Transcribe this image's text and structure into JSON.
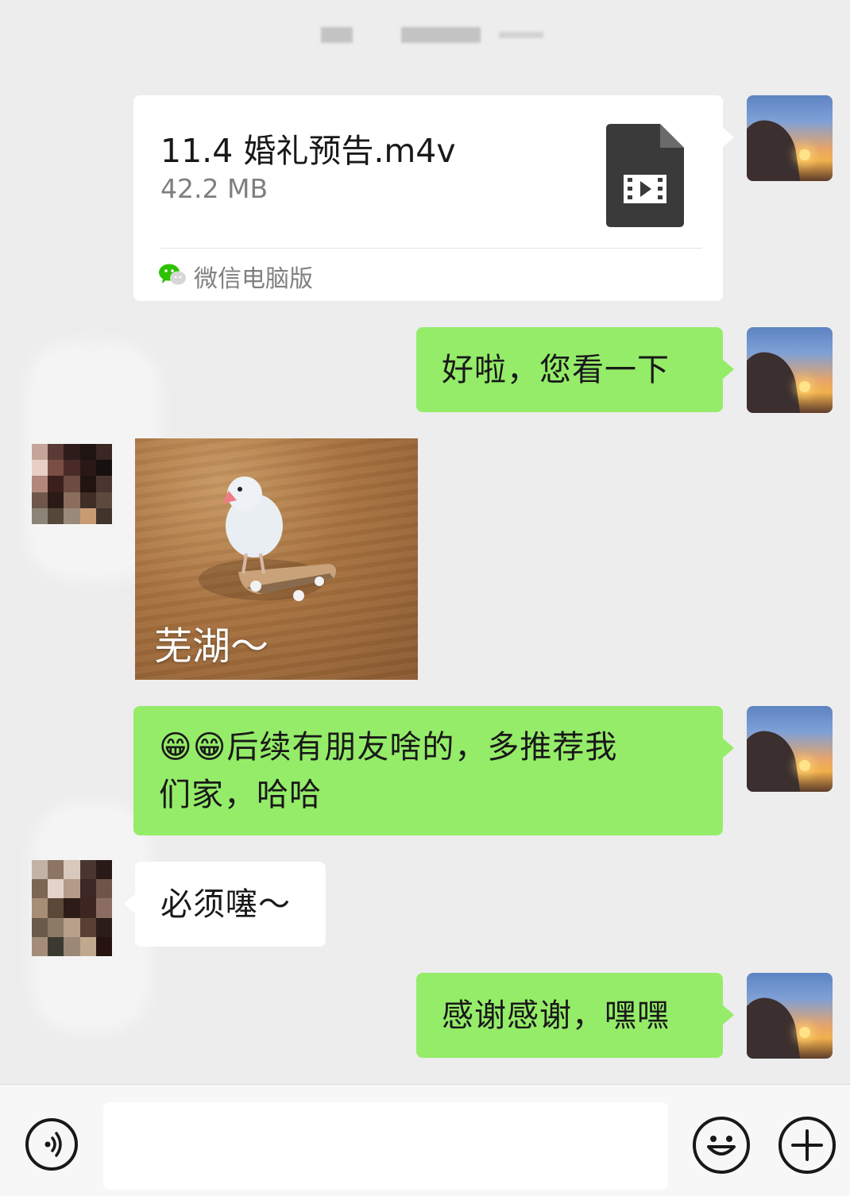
{
  "chat": {
    "messages": [
      {
        "id": "file",
        "sender": "me",
        "type": "file",
        "file_name": "11.4 婚礼预告.m4v",
        "file_size": "42.2 MB",
        "source": "微信电脑版",
        "file_icon": "video-file-icon"
      },
      {
        "id": "m1",
        "sender": "me",
        "type": "text",
        "text": "好啦，您看一下"
      },
      {
        "id": "m2",
        "sender": "other",
        "type": "image",
        "caption": "芜湖～"
      },
      {
        "id": "m3",
        "sender": "me",
        "type": "text",
        "line1": "😁😁后续有朋友啥的，多推荐我",
        "line2": "们家，哈哈"
      },
      {
        "id": "m4",
        "sender": "other",
        "type": "text",
        "text": "必须噻～"
      },
      {
        "id": "m5",
        "sender": "me",
        "type": "text",
        "text": "感谢感谢，嘿嘿"
      }
    ]
  },
  "input_bar": {
    "voice_icon": "voice-icon",
    "emoji_icon": "emoji-icon",
    "plus_icon": "plus-icon",
    "text_value": ""
  },
  "colors": {
    "background": "#ededed",
    "bubble_me": "#95ec69",
    "bubble_other": "#ffffff"
  }
}
